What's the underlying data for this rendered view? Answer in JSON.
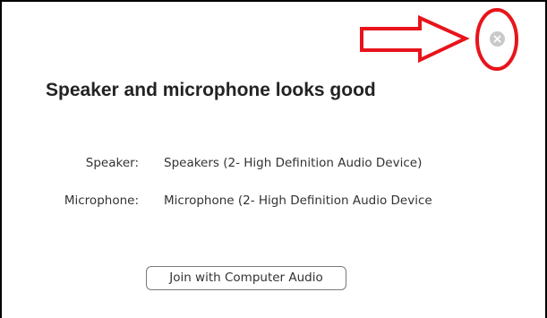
{
  "dialog": {
    "title": "Speaker and microphone looks good",
    "speaker_label": "Speaker:",
    "speaker_value": "Speakers (2- High Definition Audio Device)",
    "microphone_label": "Microphone:",
    "microphone_value": "Microphone (2- High Definition Audio Device",
    "join_button_label": "Join with Computer Audio",
    "close_icon": "close-icon"
  },
  "annotation": {
    "arrow_color": "#e8141b",
    "circle_color": "#e8141b"
  }
}
